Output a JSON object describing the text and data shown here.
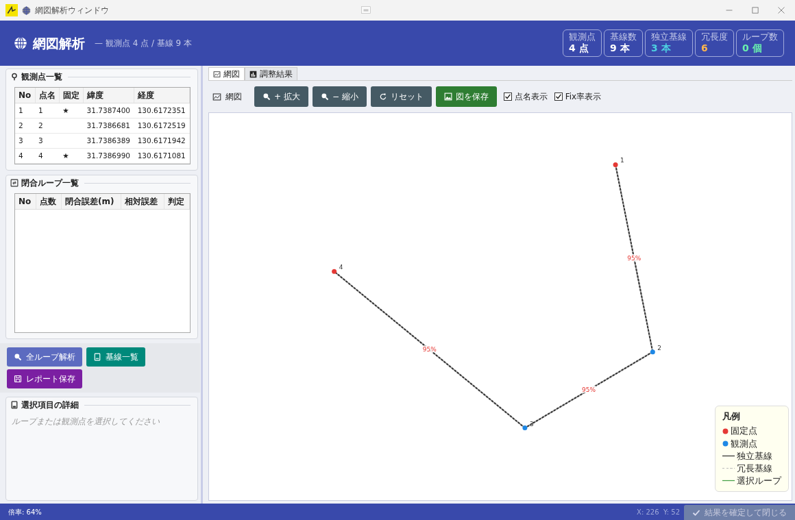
{
  "window": {
    "title": "網図解析ウィンドウ"
  },
  "header": {
    "title": "網図解析",
    "subtitle": "— 観測点 4 点 / 基線 9 本"
  },
  "stats": [
    {
      "label": "観測点",
      "value": "4 点",
      "color": "#ffffff"
    },
    {
      "label": "基線数",
      "value": "9 本",
      "color": "#ffffff"
    },
    {
      "label": "独立基線",
      "value": "3 本",
      "color": "#4dd0e1"
    },
    {
      "label": "冗長度",
      "value": "6",
      "color": "#ffb74d"
    },
    {
      "label": "ループ数",
      "value": "0 個",
      "color": "#69f0ae"
    }
  ],
  "points_panel": {
    "title": "観測点一覧",
    "columns": [
      "No",
      "点名",
      "固定",
      "緯度",
      "経度"
    ],
    "rows": [
      {
        "no": "1",
        "name": "1",
        "fixed": true,
        "fixed_mark": "★",
        "lat": "31.7387400",
        "lon": "130.6172351"
      },
      {
        "no": "2",
        "name": "2",
        "fixed": false,
        "lat": "31.7386681",
        "lon": "130.6172519"
      },
      {
        "no": "3",
        "name": "3",
        "fixed": false,
        "lat": "31.7386389",
        "lon": "130.6171942"
      },
      {
        "no": "4",
        "name": "4",
        "fixed": true,
        "fixed_mark": "★",
        "lat": "31.7386990",
        "lon": "130.6171081"
      }
    ]
  },
  "loops_panel": {
    "title": "閉合ループ一覧",
    "columns": [
      "No",
      "点数",
      "閉合誤差(m)",
      "相対誤差",
      "判定"
    ]
  },
  "actions": [
    {
      "label": "全ループ解析",
      "color": "#5c6bc0"
    },
    {
      "label": "基線一覧",
      "color": "#00897b"
    },
    {
      "label": "レポート保存",
      "color": "#7b1fa2"
    }
  ],
  "details": {
    "title": "選択項目の詳細",
    "message": "ループまたは観測点を選択してください"
  },
  "tabs": [
    {
      "label": "網図",
      "selected": true
    },
    {
      "label": "調整結果",
      "selected": false
    }
  ],
  "toolbar": {
    "label": "網図",
    "buttons": [
      {
        "label": "+ 拡大",
        "color": "#455a64"
      },
      {
        "label": "− 縮小",
        "color": "#455a64"
      },
      {
        "label": "リセット",
        "color": "#455a64"
      },
      {
        "label": "図を保存",
        "color": "#2e7d32"
      }
    ],
    "checkboxes": [
      {
        "label": "点名表示",
        "checked": true
      },
      {
        "label": "Fix率表示",
        "checked": true
      }
    ]
  },
  "network": {
    "nodes": [
      {
        "label": "1"
      },
      {
        "label": "2"
      },
      {
        "label": "3"
      },
      {
        "label": "4"
      }
    ],
    "edges": [
      {
        "label": "95%"
      },
      {
        "label": "95%"
      },
      {
        "label": "95%"
      }
    ]
  },
  "legend": {
    "title": "凡例",
    "items": [
      {
        "kind": "dot",
        "label": "固定点",
        "color": "#e53935"
      },
      {
        "kind": "dot",
        "label": "観測点",
        "color": "#1e88e5"
      },
      {
        "kind": "solid",
        "label": "独立基線",
        "color": "#333333"
      },
      {
        "kind": "dashed",
        "label": "冗長基線",
        "color": "#bdbdbd"
      },
      {
        "kind": "solid",
        "label": "選択ループ",
        "color": "#43a047"
      }
    ]
  },
  "status_bar": {
    "zoom": "倍率: 64%",
    "coords": "X: 226  Y: 52",
    "confirm_button": {
      "label": "結果を確定して閉じる",
      "disabled": true
    }
  }
}
